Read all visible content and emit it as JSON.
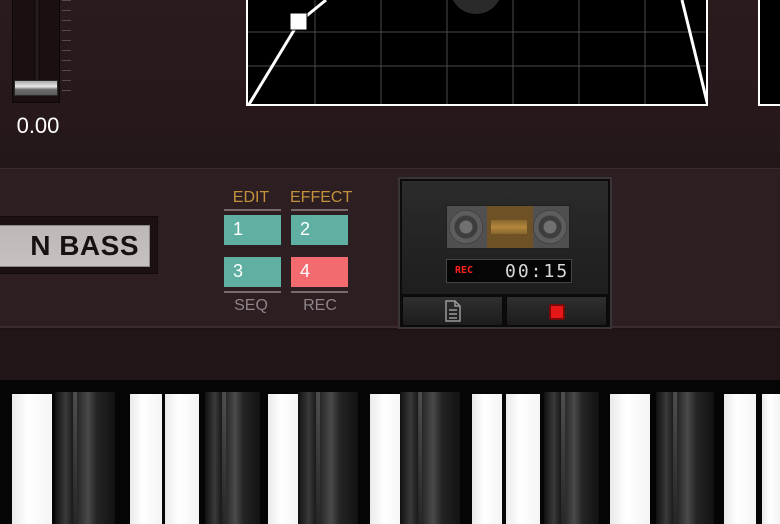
{
  "volume": {
    "value_text": "0.00",
    "level": 0.0
  },
  "envelope": {
    "graph": "envelope-graph"
  },
  "preset": {
    "name": "N BASS"
  },
  "modes": {
    "edit_label": "EDIT",
    "effect_label": "EFFECT",
    "seq_label": "SEQ",
    "rec_label": "REC",
    "buttons": [
      "1",
      "2",
      "3",
      "4"
    ]
  },
  "recorder": {
    "indicator": "REC",
    "time": "00:15",
    "doc_icon": "document-icon",
    "record_icon": "record-icon"
  },
  "colors": {
    "teal": "#5fb0a2",
    "pink": "#f36b6e",
    "label_gold": "#c4923c",
    "label_gray": "#8e8589",
    "record_red": "#e41818"
  }
}
